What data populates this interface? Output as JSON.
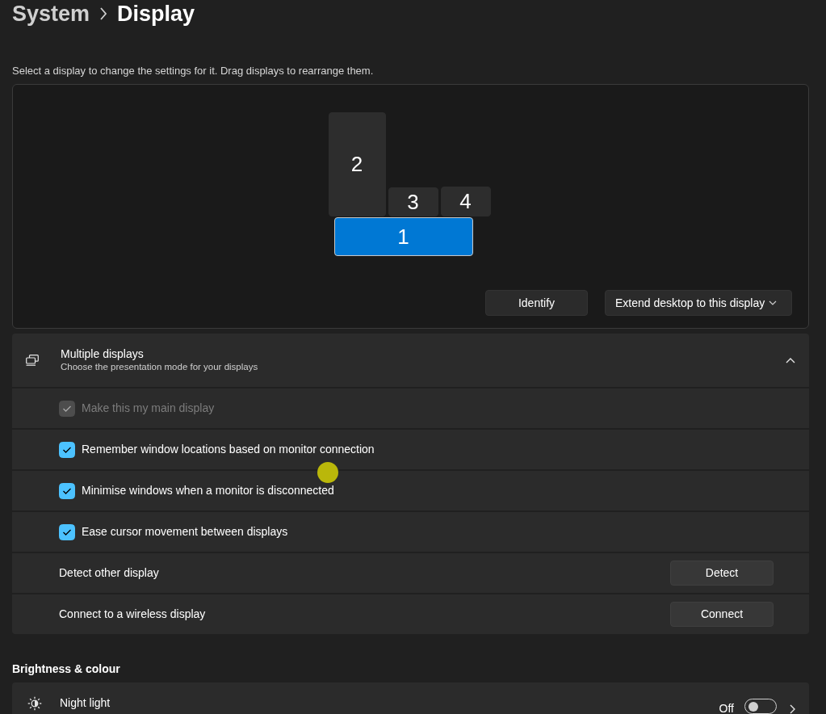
{
  "header": {
    "breadcrumb": [
      {
        "label": "System",
        "current": false
      },
      {
        "label": "Display",
        "current": true
      }
    ]
  },
  "arrangement": {
    "instruction": "Select a display to change the settings for it. Drag displays to rearrange them.",
    "monitors": [
      {
        "label": "2",
        "selected": false
      },
      {
        "label": "3",
        "selected": false
      },
      {
        "label": "4",
        "selected": false
      },
      {
        "label": "1",
        "selected": true
      }
    ],
    "buttons": [
      {
        "kind": "button",
        "label": "Identify"
      },
      {
        "kind": "dropdown",
        "label": "Extend desktop to this display"
      }
    ]
  },
  "multiple_displays": {
    "title": "Multiple displays",
    "subtitle": "Choose the presentation mode for your displays",
    "expanded": true,
    "rows": [
      {
        "kind": "checkbox",
        "label": "Make this my main display",
        "checked": true,
        "disabled": true
      },
      {
        "kind": "checkbox",
        "label": "Remember window locations based on monitor connection",
        "checked": true,
        "disabled": false
      },
      {
        "kind": "checkbox",
        "label": "Minimise windows when a monitor is disconnected",
        "checked": true,
        "disabled": false
      },
      {
        "kind": "checkbox",
        "label": "Ease cursor movement between displays",
        "checked": true,
        "disabled": false
      },
      {
        "kind": "button",
        "label": "Detect other display",
        "button": "Detect"
      },
      {
        "kind": "button",
        "label": "Connect to a wireless display",
        "button": "Connect"
      }
    ]
  },
  "brightness": {
    "heading": "Brightness & colour",
    "night_light": {
      "title": "Night light",
      "state_label": "Off",
      "on": false
    }
  },
  "cursor_highlight": true
}
